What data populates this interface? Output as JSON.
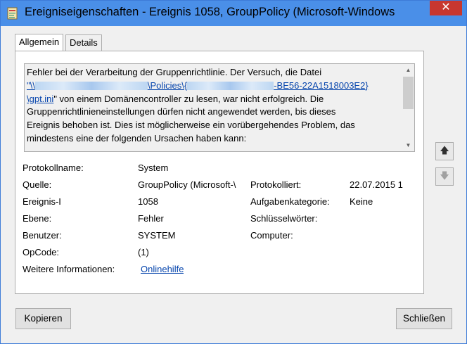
{
  "window": {
    "title": "Ereigniseigenschaften - Ereignis 1058, GroupPolicy (Microsoft-Windows",
    "close_glyph": "✕"
  },
  "tabs": [
    {
      "label": "Allgemein",
      "active": true
    },
    {
      "label": "Details",
      "active": false
    }
  ],
  "description": {
    "line1": "Fehler bei der Verarbeitung der Gruppenrichtlinie. Der Versuch, die Datei",
    "link_start": "\"\\\\",
    "link_mid": "\\Policies\\{",
    "link_end": "-BE56-22A1518003E2}",
    "link_line2": "\\gpt.ini",
    "after_link": "\" von einem Domänencontroller zu lesen, war nicht erfolgreich. Die",
    "line4": "Gruppenrichtlinieneinstellungen dürfen nicht angewendet werden, bis dieses",
    "line5": "Ereignis behoben ist. Dies ist möglicherweise ein vorübergehendes Problem, das",
    "line6": "mindestens eine der folgenden Ursachen haben kann:"
  },
  "fields": {
    "protokollname_label": "Protokollname:",
    "protokollname_value": "System",
    "quelle_label": "Quelle:",
    "quelle_value": "GroupPolicy (Microsoft-\\",
    "protokolliert_label": "Protokolliert:",
    "protokolliert_value": "22.07.2015 1",
    "ereignis_label": "Ereignis-I",
    "ereignis_value": "1058",
    "aufgabenkategorie_label": "Aufgabenkategorie:",
    "aufgabenkategorie_value": "Keine",
    "ebene_label": "Ebene:",
    "ebene_value": "Fehler",
    "schluesselwoerter_label": "Schlüsselwörter:",
    "benutzer_label": "Benutzer:",
    "benutzer_value": "SYSTEM",
    "computer_label": "Computer:",
    "opcode_label": "OpCode:",
    "opcode_value": "(1)",
    "weitere_label": "Weitere Informationen:",
    "weitere_link": "Onlinehilfe"
  },
  "buttons": {
    "copy": "Kopieren",
    "close": "Schließen"
  },
  "icons": {
    "app": "event-properties-icon",
    "up": "arrow-up-icon",
    "down": "arrow-down-icon"
  },
  "colors": {
    "titlebar": "#4a8fe8",
    "close": "#c7372f",
    "link": "#0645ad"
  }
}
